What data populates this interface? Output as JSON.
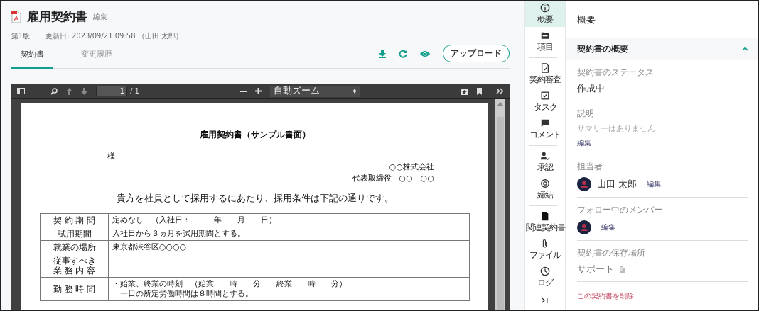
{
  "document": {
    "title": "雇用契約書",
    "edit_link": "編集",
    "version": "第1版",
    "updated": "更新日: 2023/09/21 09:58 （山田 太郎）"
  },
  "tabs": [
    {
      "label": "契約書",
      "selected": true
    },
    {
      "label": "変更履歴",
      "selected": false
    }
  ],
  "actions": {
    "upload_button": "アップロード"
  },
  "pdf_viewer": {
    "page_number": "1",
    "page_count": "/ 1",
    "zoom": "自動ズーム"
  },
  "contract": {
    "heading": "雇用契約書（サンプル書面）",
    "addressee": "様",
    "company": "○○株式会社",
    "representative": "代表取締役　○○　○○",
    "intro": "貴方を社員として採用するにあたり、採用条件は下記の通りです。",
    "rows": [
      {
        "label": [
          "契 約 期 間"
        ],
        "value": [
          "定めなし　（入社日：　　　年　　月　　日）"
        ]
      },
      {
        "label": [
          "試用期間"
        ],
        "value": [
          "入社日から３ヵ月を試用期間とする。"
        ]
      },
      {
        "label": [
          "就業の場所"
        ],
        "value": [
          "東京都渋谷区○○○○"
        ]
      },
      {
        "label": [
          "従事すべき",
          "業 務 内 容"
        ]
      },
      {
        "label": [
          "勤 務 時 間"
        ],
        "value": [
          "・始業、終業の時刻　（始業　　時　　分　　終業　　時　　分）",
          "　一日の所定労働時間は８時間とする。"
        ]
      }
    ]
  },
  "rail": {
    "groups": [
      [
        {
          "kind": "info",
          "label": "概要",
          "selected": true
        },
        {
          "kind": "folder",
          "label": "項目",
          "selected": false
        }
      ],
      [
        {
          "kind": "review",
          "label": "契約審査",
          "selected": false
        },
        {
          "kind": "task",
          "label": "タスク",
          "selected": false
        },
        {
          "kind": "comment",
          "label": "コメント",
          "selected": false
        }
      ],
      [
        {
          "kind": "approve",
          "label": "承認",
          "selected": false
        },
        {
          "kind": "sign",
          "label": "締結",
          "selected": false
        }
      ],
      [
        {
          "kind": "file",
          "label": "関連契約書",
          "selected": false
        },
        {
          "kind": "clip",
          "label": "ファイル",
          "selected": false
        },
        {
          "kind": "clock",
          "label": "ログ",
          "selected": false
        }
      ]
    ]
  },
  "panel": {
    "title": "概要",
    "section": {
      "title": "契約書の概要",
      "expanded": true
    },
    "status": {
      "label": "契約書のステータス",
      "value": "作成中"
    },
    "description": {
      "label": "説明",
      "placeholder": "サマリーはありません",
      "edit": "編集"
    },
    "assignee": {
      "label": "担当者",
      "name": "山田 太郎",
      "edit": "編集"
    },
    "followers": {
      "label": "フォロー中のメンバー",
      "edit": "編集"
    },
    "storage": {
      "label": "契約書の保存場所",
      "value": "サポート"
    },
    "delete_link": "この契約書を削除"
  }
}
